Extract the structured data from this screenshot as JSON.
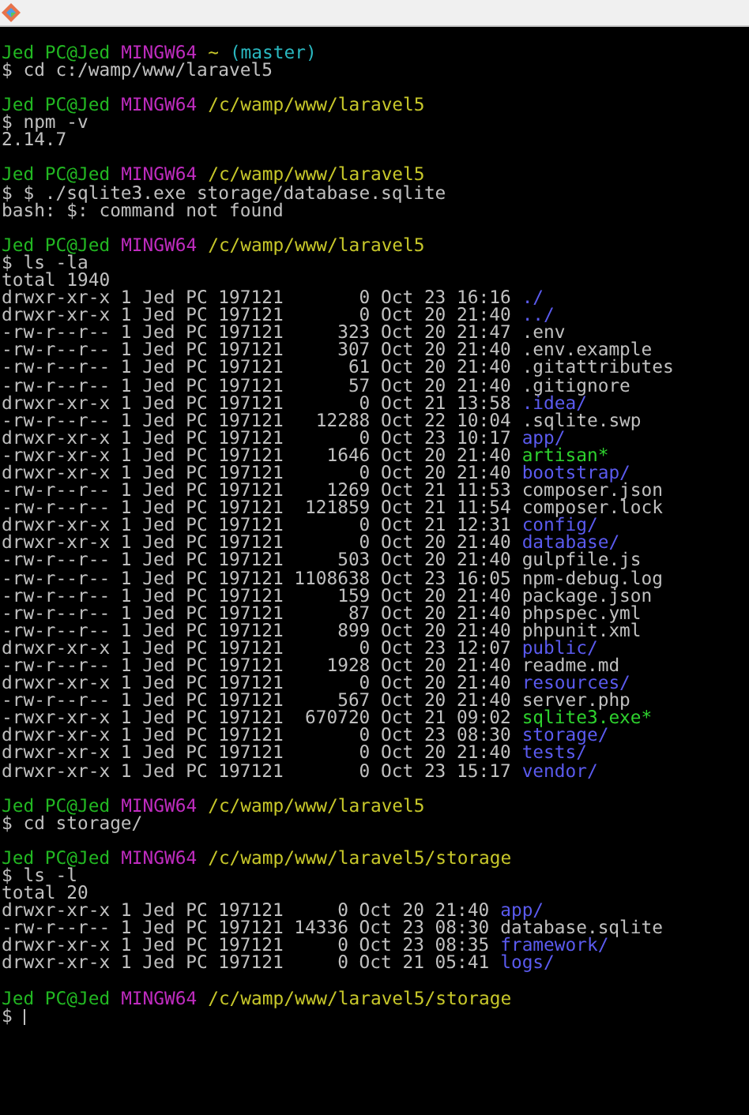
{
  "blocks": [
    {
      "user": "Jed PC@Jed",
      "system": "MINGW64",
      "path": "~",
      "branch": "(master)",
      "command": "$ cd c:/wamp/www/laravel5"
    },
    {
      "user": "Jed PC@Jed",
      "system": "MINGW64",
      "path": "/c/wamp/www/laravel5",
      "command": "$ npm -v",
      "output": [
        {
          "kind": "plain",
          "text": "2.14.7"
        }
      ]
    },
    {
      "user": "Jed PC@Jed",
      "system": "MINGW64",
      "path": "/c/wamp/www/laravel5",
      "command": "$ $ ./sqlite3.exe storage/database.sqlite",
      "output": [
        {
          "kind": "plain",
          "text": "bash: $: command not found"
        }
      ]
    },
    {
      "user": "Jed PC@Jed",
      "system": "MINGW64",
      "path": "/c/wamp/www/laravel5",
      "command": "$ ls -la",
      "output": [
        {
          "kind": "plain",
          "text": "total 1940"
        },
        {
          "kind": "dir",
          "text": "drwxr-xr-x 1 Jed PC 197121       0 Oct 23 16:16",
          "name": "./"
        },
        {
          "kind": "dir",
          "text": "drwxr-xr-x 1 Jed PC 197121       0 Oct 20 21:40",
          "name": "../"
        },
        {
          "kind": "file",
          "text": "-rw-r--r-- 1 Jed PC 197121     323 Oct 20 21:47",
          "name": ".env"
        },
        {
          "kind": "file",
          "text": "-rw-r--r-- 1 Jed PC 197121     307 Oct 20 21:40",
          "name": ".env.example"
        },
        {
          "kind": "file",
          "text": "-rw-r--r-- 1 Jed PC 197121      61 Oct 20 21:40",
          "name": ".gitattributes"
        },
        {
          "kind": "file",
          "text": "-rw-r--r-- 1 Jed PC 197121      57 Oct 20 21:40",
          "name": ".gitignore"
        },
        {
          "kind": "dir",
          "text": "drwxr-xr-x 1 Jed PC 197121       0 Oct 21 13:58",
          "name": ".idea/"
        },
        {
          "kind": "file",
          "text": "-rw-r--r-- 1 Jed PC 197121   12288 Oct 22 10:04",
          "name": ".sqlite.swp"
        },
        {
          "kind": "dir",
          "text": "drwxr-xr-x 1 Jed PC 197121       0 Oct 23 10:17",
          "name": "app/"
        },
        {
          "kind": "exe",
          "text": "-rwxr-xr-x 1 Jed PC 197121    1646 Oct 20 21:40",
          "name": "artisan*"
        },
        {
          "kind": "dir",
          "text": "drwxr-xr-x 1 Jed PC 197121       0 Oct 20 21:40",
          "name": "bootstrap/"
        },
        {
          "kind": "file",
          "text": "-rw-r--r-- 1 Jed PC 197121    1269 Oct 21 11:53",
          "name": "composer.json"
        },
        {
          "kind": "file",
          "text": "-rw-r--r-- 1 Jed PC 197121  121859 Oct 21 11:54",
          "name": "composer.lock"
        },
        {
          "kind": "dir",
          "text": "drwxr-xr-x 1 Jed PC 197121       0 Oct 21 12:31",
          "name": "config/"
        },
        {
          "kind": "dir",
          "text": "drwxr-xr-x 1 Jed PC 197121       0 Oct 20 21:40",
          "name": "database/"
        },
        {
          "kind": "file",
          "text": "-rw-r--r-- 1 Jed PC 197121     503 Oct 20 21:40",
          "name": "gulpfile.js"
        },
        {
          "kind": "file",
          "text": "-rw-r--r-- 1 Jed PC 197121 1108638 Oct 23 16:05",
          "name": "npm-debug.log"
        },
        {
          "kind": "file",
          "text": "-rw-r--r-- 1 Jed PC 197121     159 Oct 20 21:40",
          "name": "package.json"
        },
        {
          "kind": "file",
          "text": "-rw-r--r-- 1 Jed PC 197121      87 Oct 20 21:40",
          "name": "phpspec.yml"
        },
        {
          "kind": "file",
          "text": "-rw-r--r-- 1 Jed PC 197121     899 Oct 20 21:40",
          "name": "phpunit.xml"
        },
        {
          "kind": "dir",
          "text": "drwxr-xr-x 1 Jed PC 197121       0 Oct 23 12:07",
          "name": "public/"
        },
        {
          "kind": "file",
          "text": "-rw-r--r-- 1 Jed PC 197121    1928 Oct 20 21:40",
          "name": "readme.md"
        },
        {
          "kind": "dir",
          "text": "drwxr-xr-x 1 Jed PC 197121       0 Oct 20 21:40",
          "name": "resources/"
        },
        {
          "kind": "file",
          "text": "-rw-r--r-- 1 Jed PC 197121     567 Oct 20 21:40",
          "name": "server.php"
        },
        {
          "kind": "exe",
          "text": "-rwxr-xr-x 1 Jed PC 197121  670720 Oct 21 09:02",
          "name": "sqlite3.exe*"
        },
        {
          "kind": "dir",
          "text": "drwxr-xr-x 1 Jed PC 197121       0 Oct 23 08:30",
          "name": "storage/"
        },
        {
          "kind": "dir",
          "text": "drwxr-xr-x 1 Jed PC 197121       0 Oct 20 21:40",
          "name": "tests/"
        },
        {
          "kind": "dir",
          "text": "drwxr-xr-x 1 Jed PC 197121       0 Oct 23 15:17",
          "name": "vendor/"
        }
      ]
    },
    {
      "user": "Jed PC@Jed",
      "system": "MINGW64",
      "path": "/c/wamp/www/laravel5",
      "command": "$ cd storage/"
    },
    {
      "user": "Jed PC@Jed",
      "system": "MINGW64",
      "path": "/c/wamp/www/laravel5/storage",
      "command": "$ ls -l",
      "output": [
        {
          "kind": "plain",
          "text": "total 20"
        },
        {
          "kind": "dir",
          "text": "drwxr-xr-x 1 Jed PC 197121     0 Oct 20 21:40",
          "name": "app/"
        },
        {
          "kind": "file",
          "text": "-rw-r--r-- 1 Jed PC 197121 14336 Oct 23 08:30",
          "name": "database.sqlite"
        },
        {
          "kind": "dir",
          "text": "drwxr-xr-x 1 Jed PC 197121     0 Oct 23 08:35",
          "name": "framework/"
        },
        {
          "kind": "dir",
          "text": "drwxr-xr-x 1 Jed PC 197121     0 Oct 21 05:41",
          "name": "logs/"
        }
      ]
    },
    {
      "user": "Jed PC@Jed",
      "system": "MINGW64",
      "path": "/c/wamp/www/laravel5/storage",
      "command": "$",
      "cursor": true
    }
  ]
}
